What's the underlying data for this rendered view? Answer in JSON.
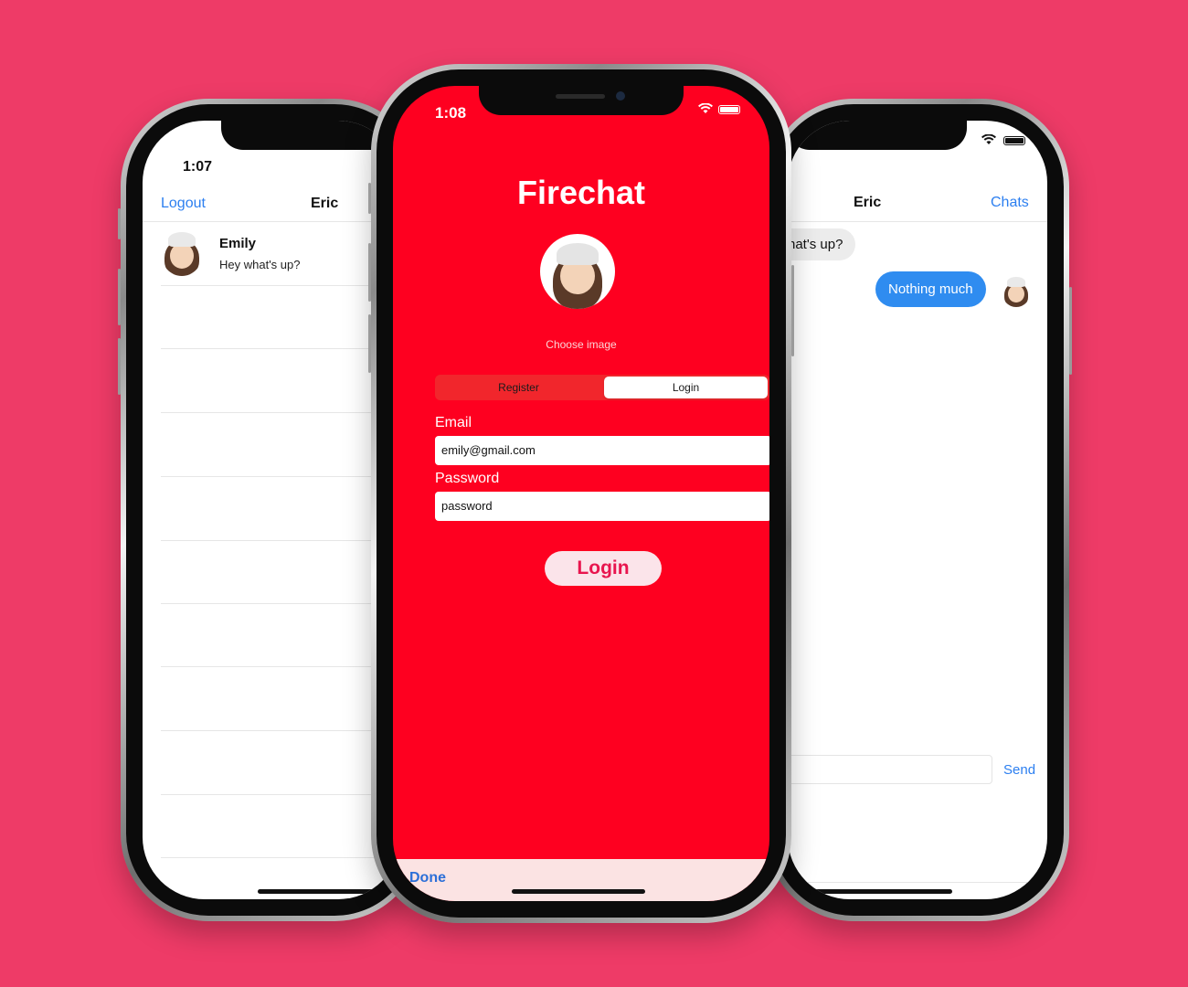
{
  "colors": {
    "background": "#ee3b67",
    "accent_blue": "#2c7ff0",
    "login_red": "#fe0020"
  },
  "left_phone": {
    "status_time": "1:07",
    "nav": {
      "left_action": "Logout",
      "title": "Eric"
    },
    "chats": [
      {
        "name": "Emily",
        "last_message": "Hey what's up?",
        "avatar_icon": "memoji-avatar-icon"
      }
    ]
  },
  "center_phone": {
    "status_time": "1:08",
    "app_title": "Firechat",
    "choose_image_label": "Choose image",
    "segments": [
      {
        "label": "Register",
        "selected": false
      },
      {
        "label": "Login",
        "selected": true
      }
    ],
    "email_label": "Email",
    "email_value": "emily@gmail.com",
    "password_label": "Password",
    "password_value": "password",
    "login_button": "Login",
    "keyboard_done": "Done"
  },
  "right_phone": {
    "nav": {
      "title": "Eric",
      "right_action": "Chats"
    },
    "messages": [
      {
        "text": "hat's up?",
        "from": "other"
      },
      {
        "text": "Nothing much",
        "from": "me"
      }
    ],
    "send_label": "Send"
  }
}
